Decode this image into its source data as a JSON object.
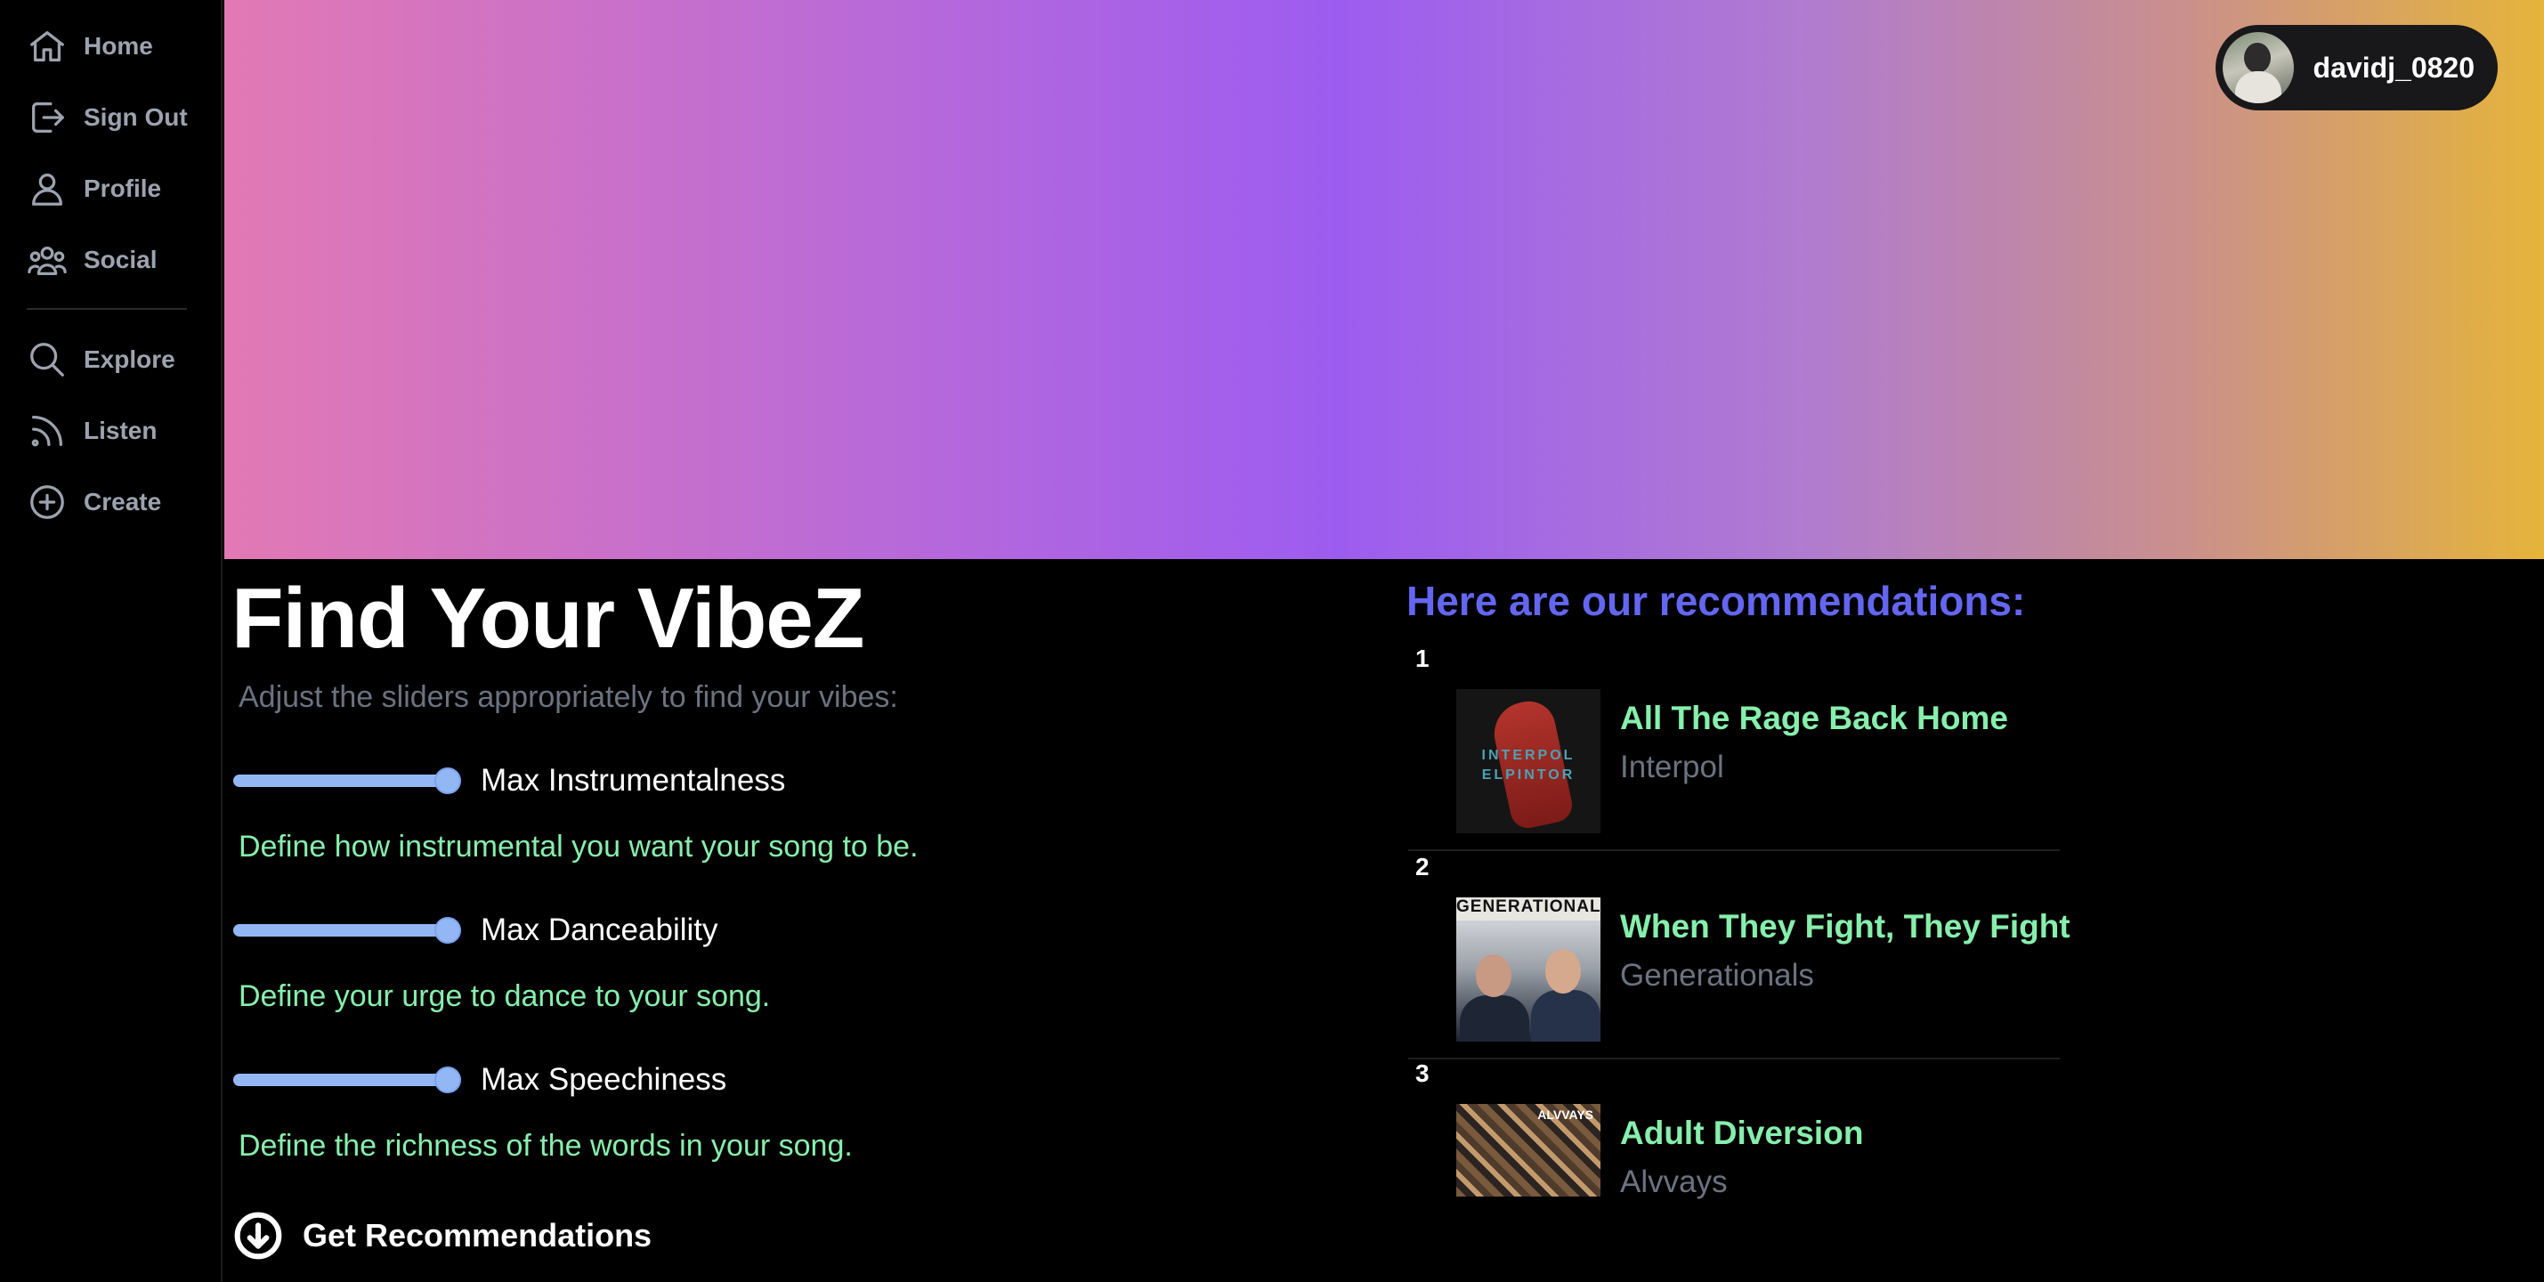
{
  "sidebar": {
    "items": [
      {
        "label": "Home",
        "icon": "home-icon"
      },
      {
        "label": "Sign Out",
        "icon": "sign-out-icon"
      },
      {
        "label": "Profile",
        "icon": "user-icon"
      },
      {
        "label": "Social",
        "icon": "users-icon"
      },
      {
        "label": "Explore",
        "icon": "search-icon"
      },
      {
        "label": "Listen",
        "icon": "rss-icon"
      },
      {
        "label": "Create",
        "icon": "plus-circle-icon"
      }
    ]
  },
  "user": {
    "name": "davidj_0820"
  },
  "main": {
    "title": "Find Your VibeZ",
    "subtitle": "Adjust the sliders appropriately to find your vibes:",
    "sliders": [
      {
        "label": "Max Instrumentalness",
        "description": "Define how instrumental you want your song to be.",
        "value": 1.0
      },
      {
        "label": "Max Danceability",
        "description": "Define your urge to dance to your song.",
        "value": 1.0
      },
      {
        "label": "Max Speechiness",
        "description": "Define the richness of the words in your song.",
        "value": 1.0
      }
    ],
    "button_label": "Get Recommendations"
  },
  "recommendations": {
    "title": "Here are our recommendations:",
    "items": [
      {
        "rank": "1",
        "song": "All The Rage Back Home",
        "artist": "Interpol",
        "cover_text_1": "INTERPOL",
        "cover_text_2": "ELPINTOR"
      },
      {
        "rank": "2",
        "song": "When They Fight, They Fight",
        "artist": "Generationals",
        "cover_text_1": "GENERATIONALS"
      },
      {
        "rank": "3",
        "song": "Adult Diversion",
        "artist": "Alvvays",
        "cover_text_1": "ALVVAYS"
      }
    ]
  },
  "colors": {
    "accent_green": "#86efac",
    "accent_indigo": "#6366f1",
    "slider_blue": "#93b7f5",
    "muted_gray": "#6b7280"
  }
}
